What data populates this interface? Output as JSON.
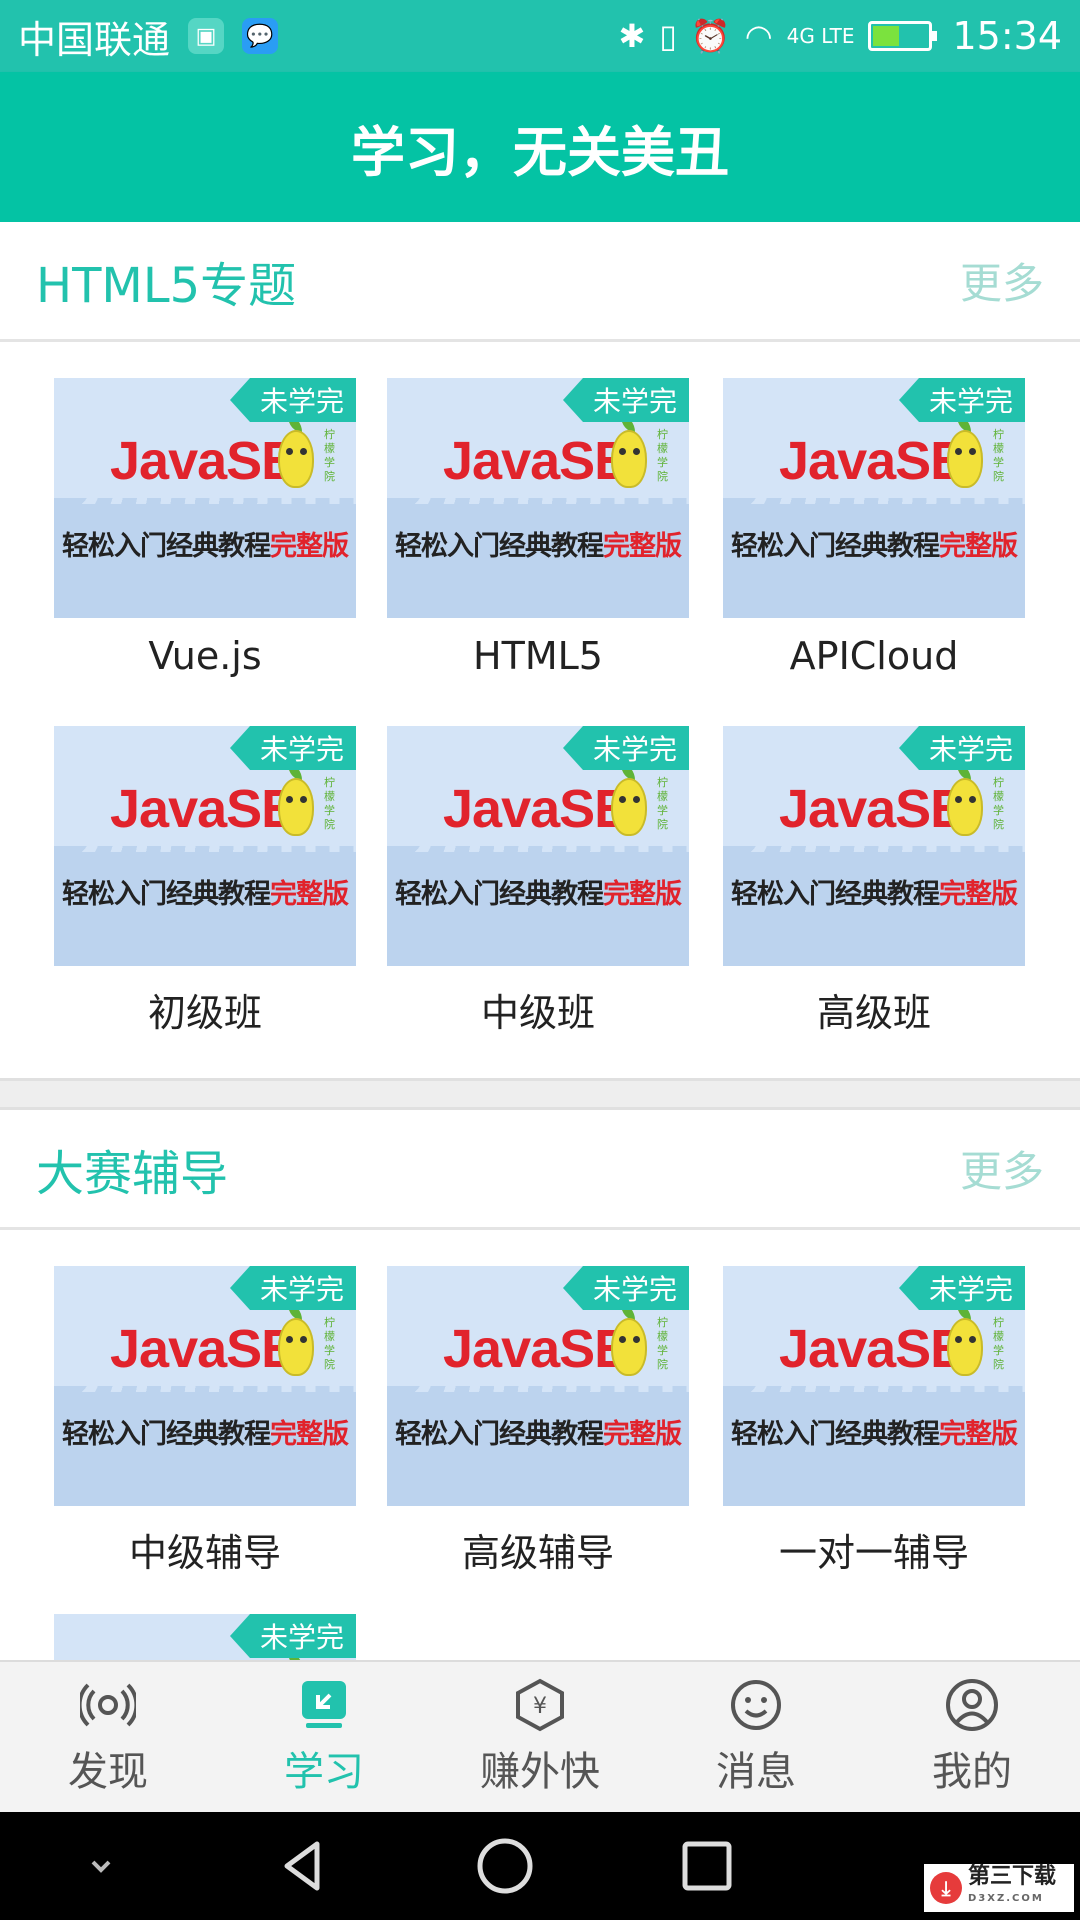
{
  "status_bar": {
    "carrier": "中国联通",
    "network": "4G LTE",
    "time": "15:34"
  },
  "header": {
    "title": "学习，无关美丑"
  },
  "sections": [
    {
      "title": "HTML5专题",
      "more": "更多",
      "items": [
        {
          "label": "Vue.js",
          "badge": "未学完"
        },
        {
          "label": "HTML5",
          "badge": "未学完"
        },
        {
          "label": "APICloud",
          "badge": "未学完"
        },
        {
          "label": "初级班",
          "badge": "未学完"
        },
        {
          "label": "中级班",
          "badge": "未学完"
        },
        {
          "label": "高级班",
          "badge": "未学完"
        }
      ]
    },
    {
      "title": "大赛辅导",
      "more": "更多",
      "items": [
        {
          "label": "中级辅导",
          "badge": "未学完"
        },
        {
          "label": "高级辅导",
          "badge": "未学完"
        },
        {
          "label": "一对一辅导",
          "badge": "未学完"
        },
        {
          "label": "",
          "badge": "未学完"
        }
      ]
    }
  ],
  "thumbnail": {
    "headline": "JavaSE",
    "subtitle_plain": "轻松入门经典教程",
    "subtitle_highlight": "完整版",
    "side_text": "柠檬学院"
  },
  "tabs": [
    {
      "label": "发现",
      "icon": "radar-icon",
      "active": false
    },
    {
      "label": "学习",
      "icon": "study-icon",
      "active": true
    },
    {
      "label": "赚外快",
      "icon": "yuan-hexagon-icon",
      "active": false
    },
    {
      "label": "消息",
      "icon": "smiley-icon",
      "active": false
    },
    {
      "label": "我的",
      "icon": "user-circle-icon",
      "active": false
    }
  ],
  "watermark": {
    "text": "第三下载",
    "sub": "D3XZ.COM"
  },
  "colors": {
    "accent": "#22c2ad",
    "header": "#04c3a4",
    "more": "#a5dcd3"
  }
}
